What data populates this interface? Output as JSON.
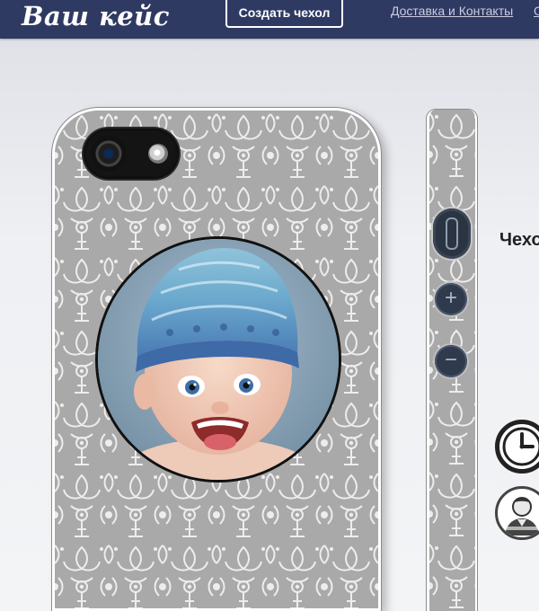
{
  "header": {
    "logo": "Ваш кейс",
    "create_button": "Создать чехол",
    "nav": {
      "delivery": "Доставка и Контакты",
      "more": "О"
    }
  },
  "side_panel": {
    "heading": "Чехо"
  },
  "icons": {
    "camera": "camera-icon",
    "clock": "clock-icon",
    "user": "user-icon",
    "plus": "+",
    "minus": "−"
  },
  "colors": {
    "header_bg": "#2f3a63",
    "case_pattern_bg": "#a9a9a9",
    "case_pattern_fg": "#ededed"
  }
}
